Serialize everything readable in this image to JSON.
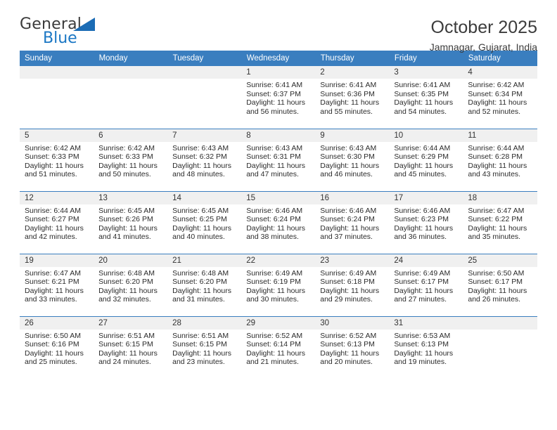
{
  "brand": {
    "name_top": "General",
    "name_bottom": "Blue",
    "triangle_icon": "triangle-icon",
    "accent_color": "#1b77c4"
  },
  "header": {
    "title": "October 2025",
    "subtitle": "Jamnagar, Gujarat, India"
  },
  "calendar": {
    "header_bg": "#3a7ebf",
    "daynum_bg": "#f0f0f0",
    "weekday_headers": [
      "Sunday",
      "Monday",
      "Tuesday",
      "Wednesday",
      "Thursday",
      "Friday",
      "Saturday"
    ],
    "weeks": [
      [
        {
          "day": "",
          "lines": []
        },
        {
          "day": "",
          "lines": []
        },
        {
          "day": "",
          "lines": []
        },
        {
          "day": "1",
          "lines": [
            "Sunrise: 6:41 AM",
            "Sunset: 6:37 PM",
            "Daylight: 11 hours and 56 minutes."
          ]
        },
        {
          "day": "2",
          "lines": [
            "Sunrise: 6:41 AM",
            "Sunset: 6:36 PM",
            "Daylight: 11 hours and 55 minutes."
          ]
        },
        {
          "day": "3",
          "lines": [
            "Sunrise: 6:41 AM",
            "Sunset: 6:35 PM",
            "Daylight: 11 hours and 54 minutes."
          ]
        },
        {
          "day": "4",
          "lines": [
            "Sunrise: 6:42 AM",
            "Sunset: 6:34 PM",
            "Daylight: 11 hours and 52 minutes."
          ]
        }
      ],
      [
        {
          "day": "5",
          "lines": [
            "Sunrise: 6:42 AM",
            "Sunset: 6:33 PM",
            "Daylight: 11 hours and 51 minutes."
          ]
        },
        {
          "day": "6",
          "lines": [
            "Sunrise: 6:42 AM",
            "Sunset: 6:33 PM",
            "Daylight: 11 hours and 50 minutes."
          ]
        },
        {
          "day": "7",
          "lines": [
            "Sunrise: 6:43 AM",
            "Sunset: 6:32 PM",
            "Daylight: 11 hours and 48 minutes."
          ]
        },
        {
          "day": "8",
          "lines": [
            "Sunrise: 6:43 AM",
            "Sunset: 6:31 PM",
            "Daylight: 11 hours and 47 minutes."
          ]
        },
        {
          "day": "9",
          "lines": [
            "Sunrise: 6:43 AM",
            "Sunset: 6:30 PM",
            "Daylight: 11 hours and 46 minutes."
          ]
        },
        {
          "day": "10",
          "lines": [
            "Sunrise: 6:44 AM",
            "Sunset: 6:29 PM",
            "Daylight: 11 hours and 45 minutes."
          ]
        },
        {
          "day": "11",
          "lines": [
            "Sunrise: 6:44 AM",
            "Sunset: 6:28 PM",
            "Daylight: 11 hours and 43 minutes."
          ]
        }
      ],
      [
        {
          "day": "12",
          "lines": [
            "Sunrise: 6:44 AM",
            "Sunset: 6:27 PM",
            "Daylight: 11 hours and 42 minutes."
          ]
        },
        {
          "day": "13",
          "lines": [
            "Sunrise: 6:45 AM",
            "Sunset: 6:26 PM",
            "Daylight: 11 hours and 41 minutes."
          ]
        },
        {
          "day": "14",
          "lines": [
            "Sunrise: 6:45 AM",
            "Sunset: 6:25 PM",
            "Daylight: 11 hours and 40 minutes."
          ]
        },
        {
          "day": "15",
          "lines": [
            "Sunrise: 6:46 AM",
            "Sunset: 6:24 PM",
            "Daylight: 11 hours and 38 minutes."
          ]
        },
        {
          "day": "16",
          "lines": [
            "Sunrise: 6:46 AM",
            "Sunset: 6:24 PM",
            "Daylight: 11 hours and 37 minutes."
          ]
        },
        {
          "day": "17",
          "lines": [
            "Sunrise: 6:46 AM",
            "Sunset: 6:23 PM",
            "Daylight: 11 hours and 36 minutes."
          ]
        },
        {
          "day": "18",
          "lines": [
            "Sunrise: 6:47 AM",
            "Sunset: 6:22 PM",
            "Daylight: 11 hours and 35 minutes."
          ]
        }
      ],
      [
        {
          "day": "19",
          "lines": [
            "Sunrise: 6:47 AM",
            "Sunset: 6:21 PM",
            "Daylight: 11 hours and 33 minutes."
          ]
        },
        {
          "day": "20",
          "lines": [
            "Sunrise: 6:48 AM",
            "Sunset: 6:20 PM",
            "Daylight: 11 hours and 32 minutes."
          ]
        },
        {
          "day": "21",
          "lines": [
            "Sunrise: 6:48 AM",
            "Sunset: 6:20 PM",
            "Daylight: 11 hours and 31 minutes."
          ]
        },
        {
          "day": "22",
          "lines": [
            "Sunrise: 6:49 AM",
            "Sunset: 6:19 PM",
            "Daylight: 11 hours and 30 minutes."
          ]
        },
        {
          "day": "23",
          "lines": [
            "Sunrise: 6:49 AM",
            "Sunset: 6:18 PM",
            "Daylight: 11 hours and 29 minutes."
          ]
        },
        {
          "day": "24",
          "lines": [
            "Sunrise: 6:49 AM",
            "Sunset: 6:17 PM",
            "Daylight: 11 hours and 27 minutes."
          ]
        },
        {
          "day": "25",
          "lines": [
            "Sunrise: 6:50 AM",
            "Sunset: 6:17 PM",
            "Daylight: 11 hours and 26 minutes."
          ]
        }
      ],
      [
        {
          "day": "26",
          "lines": [
            "Sunrise: 6:50 AM",
            "Sunset: 6:16 PM",
            "Daylight: 11 hours and 25 minutes."
          ]
        },
        {
          "day": "27",
          "lines": [
            "Sunrise: 6:51 AM",
            "Sunset: 6:15 PM",
            "Daylight: 11 hours and 24 minutes."
          ]
        },
        {
          "day": "28",
          "lines": [
            "Sunrise: 6:51 AM",
            "Sunset: 6:15 PM",
            "Daylight: 11 hours and 23 minutes."
          ]
        },
        {
          "day": "29",
          "lines": [
            "Sunrise: 6:52 AM",
            "Sunset: 6:14 PM",
            "Daylight: 11 hours and 21 minutes."
          ]
        },
        {
          "day": "30",
          "lines": [
            "Sunrise: 6:52 AM",
            "Sunset: 6:13 PM",
            "Daylight: 11 hours and 20 minutes."
          ]
        },
        {
          "day": "31",
          "lines": [
            "Sunrise: 6:53 AM",
            "Sunset: 6:13 PM",
            "Daylight: 11 hours and 19 minutes."
          ]
        },
        {
          "day": "",
          "lines": []
        }
      ]
    ]
  }
}
